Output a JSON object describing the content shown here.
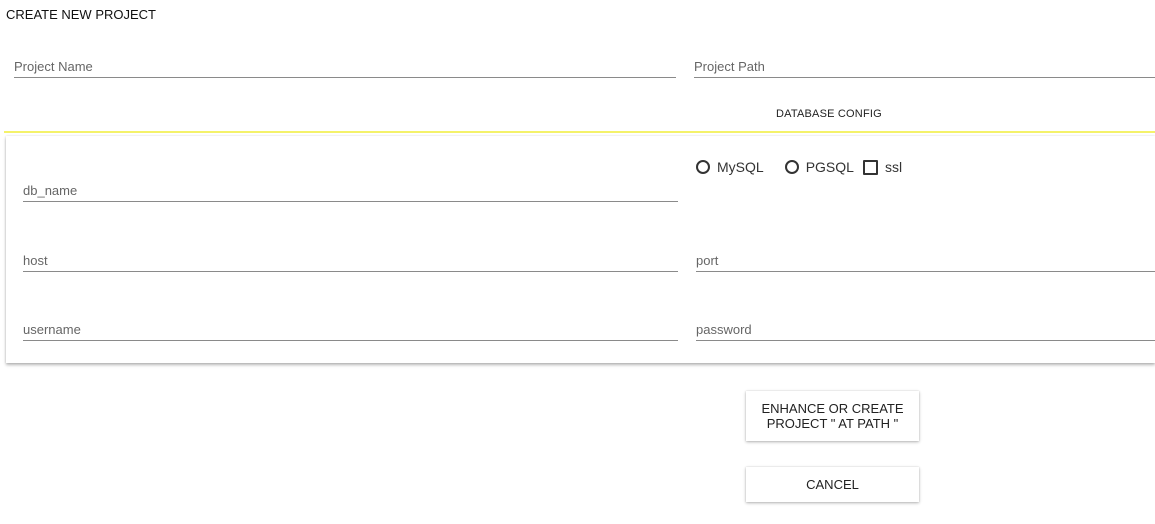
{
  "page": {
    "title": "CREATE NEW PROJECT"
  },
  "project": {
    "name_placeholder": "Project Name",
    "path_placeholder": "Project Path"
  },
  "database": {
    "section_label": "DATABASE CONFIG",
    "db_name_placeholder": "db_name",
    "host_placeholder": "host",
    "port_placeholder": "port",
    "username_placeholder": "username",
    "password_placeholder": "password",
    "options": {
      "mysql_label": "MySQL",
      "mysql_selected": false,
      "pgsql_label": "PGSQL",
      "pgsql_selected": false,
      "ssl_label": "ssl",
      "ssl_checked": false
    }
  },
  "actions": {
    "enhance_label": "ENHANCE OR CREATE PROJECT \" AT PATH \"",
    "cancel_label": "CANCEL"
  },
  "colors": {
    "section_divider": "#f4f26a",
    "underline": "#8a8a8a"
  }
}
